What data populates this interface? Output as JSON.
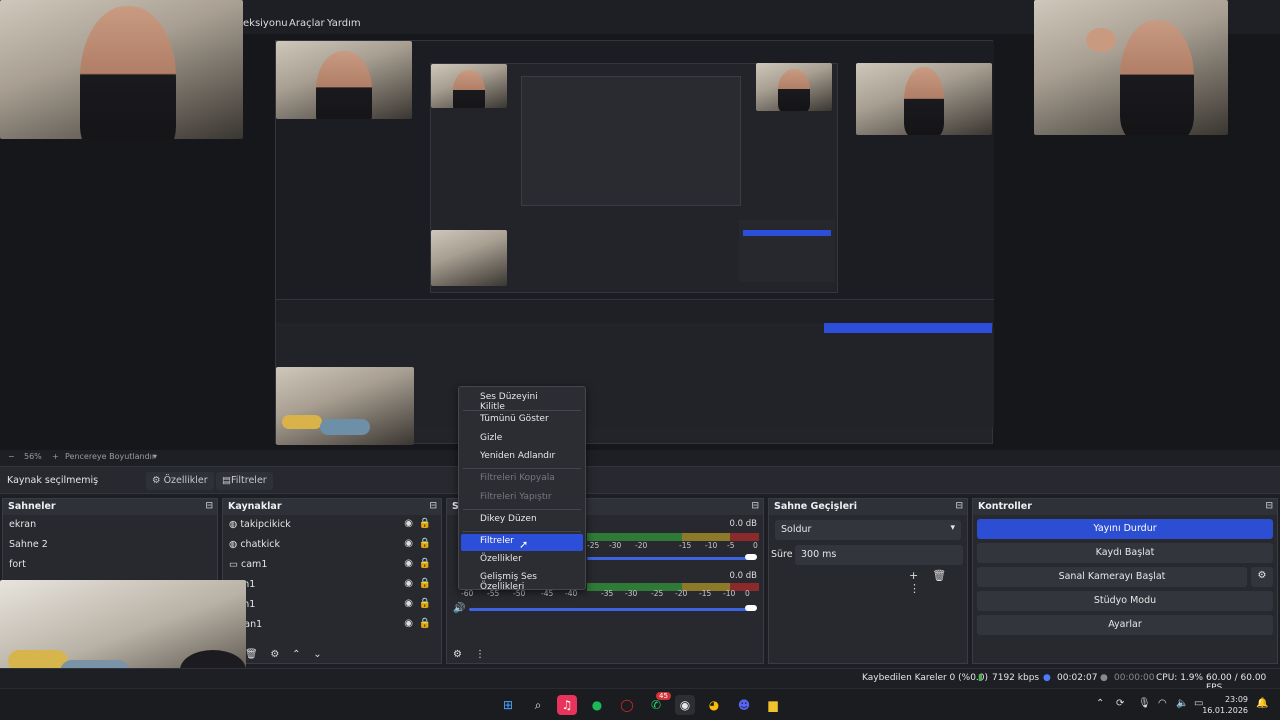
{
  "menu": {
    "items": [
      "eksiyonu",
      "Araçlar",
      "Yardım"
    ]
  },
  "zoom": {
    "value": "56%",
    "fit_label": "Pencereye Boyutlandır"
  },
  "sourcebar": {
    "title": "Kaynak seçilmemiş",
    "properties": "Özellikler",
    "filters": "Filtreler"
  },
  "docks": {
    "scenes": {
      "title": "Sahneler",
      "items": [
        "ekran",
        "Sahne 2",
        "fort"
      ]
    },
    "sources": {
      "title": "Kaynaklar",
      "items": [
        "takipcikick",
        "chatkick",
        "cam1",
        "cam1",
        "cam1",
        "ekran1"
      ]
    },
    "mixer": {
      "title": "Se",
      "db1": "0.0 dB",
      "db2": "0.0 dB",
      "scale": [
        "-60",
        "-55",
        "-50",
        "-45",
        "-40",
        "-35",
        "-30",
        "-25",
        "-20",
        "-15",
        "-10",
        "-5",
        "0"
      ]
    },
    "transitions": {
      "title": "Sahne Geçişleri",
      "selected": "Soldur",
      "duration_label": "Süre",
      "duration_value": "300 ms"
    },
    "controls": {
      "title": "Kontroller",
      "buttons": [
        "Yayını Durdur",
        "Kaydı Başlat",
        "Sanal Kamerayı Başlat",
        "Stüdyo Modu",
        "Ayarlar"
      ]
    }
  },
  "context_menu": {
    "items": [
      "Ses Düzeyini Kilitle",
      "Tümünü Göster",
      "Gizle",
      "Yeniden Adlandır",
      "Filtreleri Kopyala",
      "Filtreleri Yapıştır",
      "Dikey Düzen",
      "Filtreler",
      "Özellikler",
      "Gelişmiş Ses Özellikleri"
    ],
    "highlighted": "Filtreler"
  },
  "status": {
    "dropped": "Kaybedilen Kareler 0 (%0.0)",
    "bitrate": "7192 kbps",
    "stream_time": "00:02:07",
    "rec_time": "00:00:00",
    "cpu": "CPU: 1.9%",
    "fps": "60.00 / 60.00 FPS"
  },
  "taskbar": {
    "badge1": "45",
    "time": "23:09",
    "date": "16.01.2026"
  },
  "colors": {
    "accent": "#2c4ed8",
    "panel": "#27292f",
    "background": "#1e1f24"
  }
}
